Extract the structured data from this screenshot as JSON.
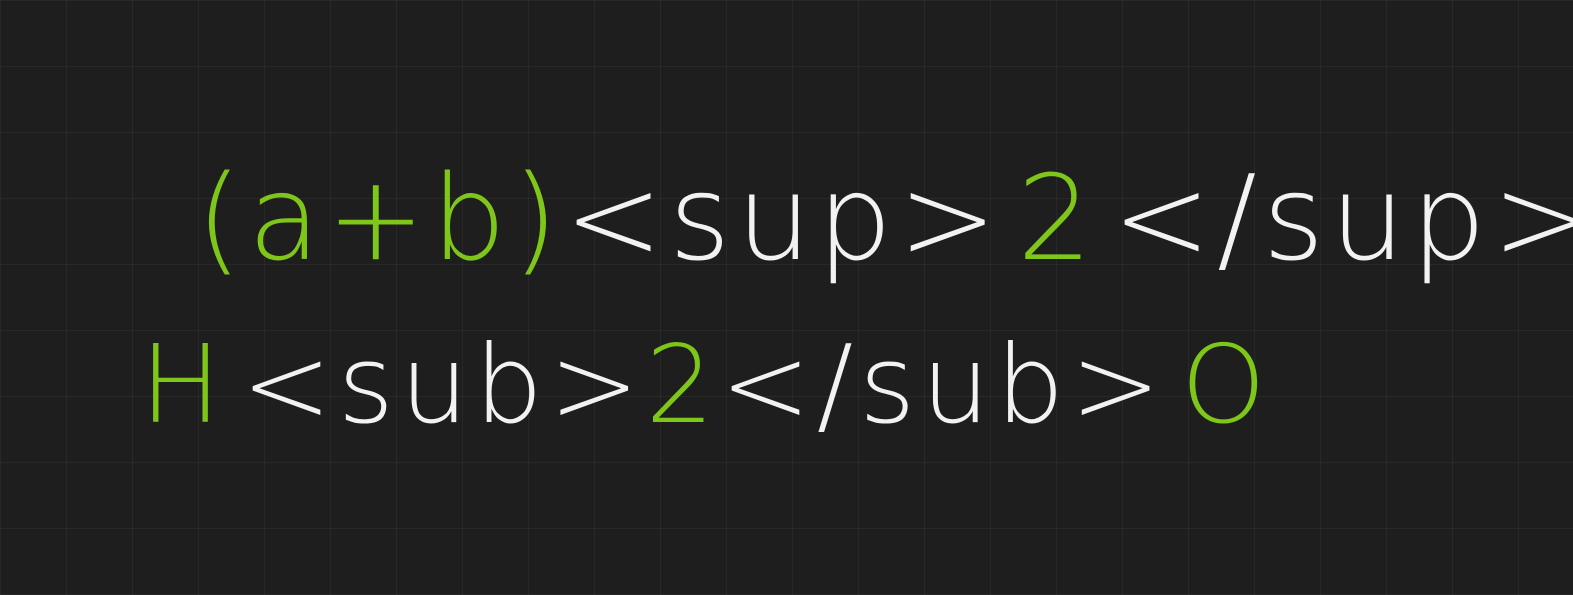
{
  "colors": {
    "background": "#1e1e1e",
    "highlight": "#7ec61a",
    "ink": "#f2f2f2"
  },
  "line1": {
    "expr": "(a+b)",
    "open_tag": "<sup>",
    "value": "2",
    "close_tag": "</sup>"
  },
  "line2": {
    "base": "H",
    "open_tag": "<sub>",
    "value": "2",
    "close_tag": "</sub>",
    "tail": "O"
  }
}
